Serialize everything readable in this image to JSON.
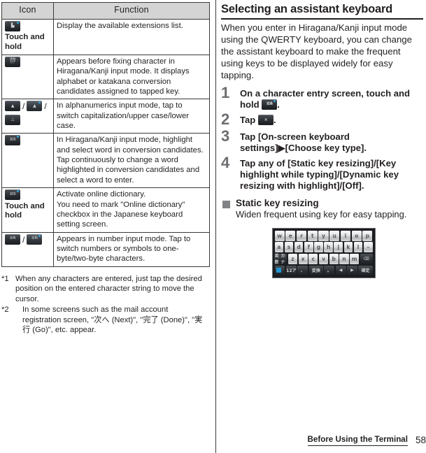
{
  "table": {
    "headers": [
      "Icon",
      "Function"
    ],
    "rows": [
      {
        "icons": [
          {
            "glyph": "∴",
            "style": "dot"
          }
        ],
        "touch_and_hold": "Touch and\nhold",
        "function": "Display the available extensions list."
      },
      {
        "icons": [
          {
            "glyph": "英数\nカナ",
            "style": "two"
          }
        ],
        "touch_and_hold": "",
        "function": "Appears before fixing character in Hiragana/Kanji input mode. It displays alphabet or katakana conversion candidates assigned to tapped key."
      },
      {
        "icons": [
          {
            "glyph": "▲",
            "style": "plain"
          },
          {
            "glyph": "▲",
            "style": "dot"
          },
          {
            "glyph": "△",
            "style": "plain"
          }
        ],
        "touch_and_hold": "",
        "function": "In alphanumerics input mode, tap to switch capitalization/upper case/lower case."
      },
      {
        "icons": [
          {
            "glyph": "変換",
            "style": "dot"
          }
        ],
        "touch_and_hold": "",
        "function": "In Hiragana/Kanji input mode, highlight and select word in conversion candidates. Tap continuously to change a word highlighted in conversion candidates and select a word to enter."
      },
      {
        "icons": [
          {
            "glyph": "変換",
            "style": "dot"
          }
        ],
        "touch_and_hold": "Touch and\nhold",
        "function": "Activate online dictionary.\nYou need to mark \"Online dictionary\" checkbox in the Japanese keyboard setting screen."
      },
      {
        "icons": [
          {
            "glyph": "全角",
            "style": "plain"
          },
          {
            "glyph": "全角",
            "style": "dot"
          }
        ],
        "touch_and_hold": "",
        "function": "Appears in number input mode. Tap to switch numbers or symbols to one-byte/two-byte characters."
      }
    ]
  },
  "footnotes": [
    {
      "mark": "*1",
      "text": "When any characters are entered, just tap the desired position on the entered character string to move the cursor."
    },
    {
      "mark": "*2",
      "line1": "In some screens such as the mail account",
      "line2": "registration screen, \"次へ (Next)\", \"完了 (Done)\", \"実行 (Go)\", etc. appear."
    }
  ],
  "section": {
    "title": "Selecting an assistant keyboard",
    "lead": "When you enter in Hiragana/Kanji input mode using the QWERTY keyboard, you can change the assistant keyboard to make the frequent using keys to be displayed widely for easy tapping.",
    "steps": [
      {
        "num": "1",
        "text_before": "On a character entry screen, touch and hold",
        "icon": "変換",
        "text_after": "."
      },
      {
        "num": "2",
        "text_before": "Tap",
        "icon": "×",
        "text_after": "."
      },
      {
        "num": "3",
        "text_before": "Tap [On-screen keyboard settings]▶[Choose key type].",
        "icon": "",
        "text_after": ""
      },
      {
        "num": "4",
        "text_before": "Tap any of [Static key resizing]/[Key highlight while typing]/[Dynamic key resizing with highlight]/[Off].",
        "icon": "",
        "text_after": ""
      }
    ],
    "bullet": {
      "title": "Static key resizing",
      "subtitle": "Widen frequent using key for easy tapping."
    }
  },
  "keyboard": {
    "row1": [
      "w",
      "e",
      "r",
      "t",
      "y",
      "u",
      "i",
      "o",
      "p"
    ],
    "row2": [
      "a",
      "s",
      "d",
      "f",
      "g",
      "h",
      "j",
      "k",
      "l",
      "–"
    ],
    "row3_left": "英数\nカナ",
    "row3": [
      "z",
      "x",
      "c",
      "v",
      "b",
      "n",
      "m"
    ],
    "row3_right": "⌫",
    "row4": [
      "A",
      "12ア",
      "、",
      "変換",
      "。",
      "◀",
      "▶",
      "確定"
    ]
  },
  "footer": {
    "title": "Before Using the Terminal",
    "page": "58"
  }
}
